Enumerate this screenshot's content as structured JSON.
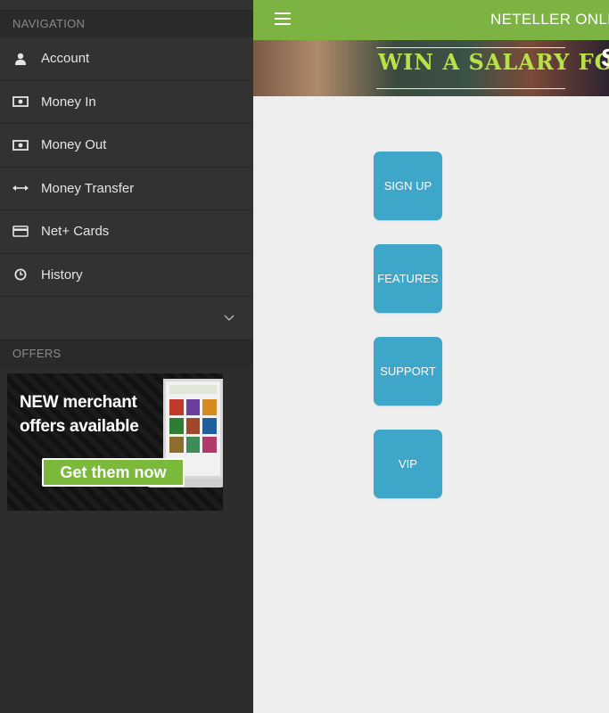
{
  "sidebar": {
    "navigation_label": "NAVIGATION",
    "items": [
      {
        "label": "Account",
        "icon": "user-icon"
      },
      {
        "label": "Money In",
        "icon": "banknote-icon"
      },
      {
        "label": "Money Out",
        "icon": "banknote-icon"
      },
      {
        "label": "Money Transfer",
        "icon": "transfer-arrows-icon"
      },
      {
        "label": "Net+ Cards",
        "icon": "credit-card-icon"
      },
      {
        "label": "History",
        "icon": "clock-icon"
      }
    ],
    "expander_icon": "chevron-down-icon",
    "offers_label": "OFFERS",
    "offer": {
      "line1": "NEW merchant",
      "line2": "offers available",
      "cta": "Get them now"
    }
  },
  "header": {
    "title": "NETELLER ONLI",
    "menu_icon": "hamburger-icon"
  },
  "promo": {
    "text": "WIN A SALARY FOR A YEAR",
    "side_text": "S"
  },
  "tiles": [
    {
      "label": "SIGN UP"
    },
    {
      "label": "FEATURES"
    },
    {
      "label": "SUPPORT"
    },
    {
      "label": "VIP"
    }
  ],
  "colors": {
    "header_green": "#7cb342",
    "tile_blue": "#3ea6c8",
    "sidebar_bg": "#2d2d2d",
    "content_bg": "#edeeed",
    "cta_green": "#7ab93a"
  }
}
